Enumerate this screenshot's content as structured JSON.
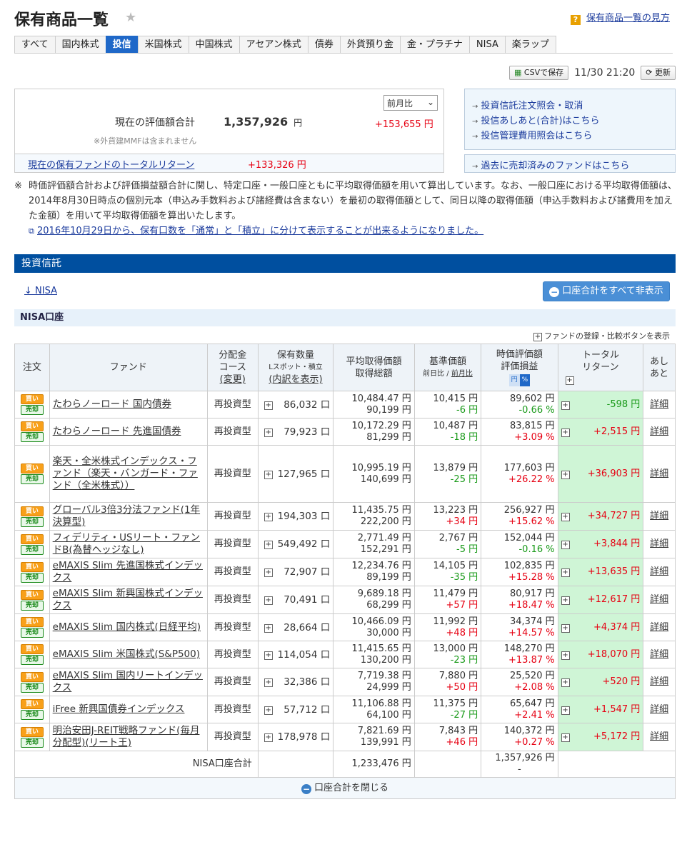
{
  "header": {
    "title": "保有商品一覧",
    "help_link": "保有商品一覧の見方",
    "help_mark": "?"
  },
  "tabs": [
    "すべて",
    "国内株式",
    "投信",
    "米国株式",
    "中国株式",
    "アセアン株式",
    "債券",
    "外貨預り金",
    "金・プラチナ",
    "NISA",
    "楽ラップ"
  ],
  "toolbar": {
    "csv": "CSVで保存",
    "timestamp": "11/30 21:20",
    "refresh": "更新"
  },
  "summary": {
    "label": "現在の評価額合計",
    "note": "※外貨建MMFは含まれません",
    "amount": "1,357,926",
    "yen": "円",
    "compare": "前月比",
    "delta": "+153,655 円",
    "total_return_label": "現在の保有ファンドのトータルリターン",
    "total_return_value": "+133,326 円"
  },
  "side_links": [
    "投資信託注文照会・取消",
    "投信あしあと(合計)はこちら",
    "投信管理費用照会はこちら",
    "過去に売却済みのファンドはこちら"
  ],
  "note": {
    "mark": "※",
    "text": "時価評価額合計および評価損益額合計に関し、特定口座・一般口座ともに平均取得価額を用いて算出しています。なお、一般口座における平均取得価額は、2014年8月30日時点の個別元本（申込み手数料および諸経費は含まない）を最初の取得価額として、同日以降の取得価額（申込手数料および諸費用を加えた金額）を用いて平均取得価額を算出いたします。",
    "link": "2016年10月29日から、保有口数を「通常」と「積立」に分けて表示することが出来るようになりました。"
  },
  "section": {
    "title": "投資信託",
    "nisa_link": "↓ NISA",
    "hide_all": "口座合計をすべて非表示",
    "subsection": "NISA口座",
    "register": "ファンドの登録・比較ボタンを表示"
  },
  "table": {
    "headers": {
      "order": "注文",
      "fund": "ファンド",
      "course1": "分配金",
      "course2": "コース",
      "course3": "(変更)",
      "qty1": "保有数量",
      "qty2": "Lスポット・積立",
      "qty3": "(内訳を表示)",
      "avg1": "平均取得価額",
      "avg2": "取得総額",
      "base1": "基準価額",
      "base2": "前日比 / ",
      "base3": "前月比",
      "eval1": "時価評価額",
      "eval2": "評価損益",
      "eval_yen": "円",
      "eval_pct": "%",
      "ret1": "トータル",
      "ret2": "リターン",
      "foot1": "あし",
      "foot2": "あと"
    },
    "buy": "買い",
    "sell": "売却",
    "detail": "詳細",
    "rows": [
      {
        "fund": "たわらノーロード 国内債券",
        "course": "再投資型",
        "qty": "86,032 口",
        "avg": "10,484.47 円",
        "total": "90,199 円",
        "base": "10,415 円",
        "base_chg": "-6 円",
        "eval": "89,602 円",
        "eval_pct": "-0.66 %",
        "ret": "-598 円",
        "pos_chg": false,
        "pos_pct": false,
        "pos_ret": false
      },
      {
        "fund": "たわらノーロード 先進国債券",
        "course": "再投資型",
        "qty": "79,923 口",
        "avg": "10,172.29 円",
        "total": "81,299 円",
        "base": "10,487 円",
        "base_chg": "-18 円",
        "eval": "83,815 円",
        "eval_pct": "+3.09 %",
        "ret": "+2,515 円",
        "pos_chg": false,
        "pos_pct": true,
        "pos_ret": true
      },
      {
        "fund": "楽天・全米株式インデックス・ファンド（楽天・バンガード・ファンド（全米株式））",
        "course": "再投資型",
        "qty": "127,965 口",
        "avg": "10,995.19 円",
        "total": "140,699 円",
        "base": "13,879 円",
        "base_chg": "-25 円",
        "eval": "177,603 円",
        "eval_pct": "+26.22 %",
        "ret": "+36,903 円",
        "pos_chg": false,
        "pos_pct": true,
        "pos_ret": true
      },
      {
        "fund": "グローバル3倍3分法ファンド(1年決算型)",
        "course": "再投資型",
        "qty": "194,303 口",
        "avg": "11,435.75 円",
        "total": "222,200 円",
        "base": "13,223 円",
        "base_chg": "+34 円",
        "eval": "256,927 円",
        "eval_pct": "+15.62 %",
        "ret": "+34,727 円",
        "pos_chg": true,
        "pos_pct": true,
        "pos_ret": true
      },
      {
        "fund": "フィデリティ・USリート・ファンドB(為替ヘッジなし)",
        "course": "再投資型",
        "qty": "549,492 口",
        "avg": "2,771.49 円",
        "total": "152,291 円",
        "base": "2,767 円",
        "base_chg": "-5 円",
        "eval": "152,044 円",
        "eval_pct": "-0.16 %",
        "ret": "+3,844 円",
        "pos_chg": false,
        "pos_pct": false,
        "pos_ret": true
      },
      {
        "fund": "eMAXIS Slim 先進国株式インデックス",
        "course": "再投資型",
        "qty": "72,907 口",
        "avg": "12,234.76 円",
        "total": "89,199 円",
        "base": "14,105 円",
        "base_chg": "-35 円",
        "eval": "102,835 円",
        "eval_pct": "+15.28 %",
        "ret": "+13,635 円",
        "pos_chg": false,
        "pos_pct": true,
        "pos_ret": true
      },
      {
        "fund": "eMAXIS Slim 新興国株式インデックス",
        "course": "再投資型",
        "qty": "70,491 口",
        "avg": "9,689.18 円",
        "total": "68,299 円",
        "base": "11,479 円",
        "base_chg": "+57 円",
        "eval": "80,917 円",
        "eval_pct": "+18.47 %",
        "ret": "+12,617 円",
        "pos_chg": true,
        "pos_pct": true,
        "pos_ret": true
      },
      {
        "fund": "eMAXIS Slim 国内株式(日経平均)",
        "course": "再投資型",
        "qty": "28,664 口",
        "avg": "10,466.09 円",
        "total": "30,000 円",
        "base": "11,992 円",
        "base_chg": "+48 円",
        "eval": "34,374 円",
        "eval_pct": "+14.57 %",
        "ret": "+4,374 円",
        "pos_chg": true,
        "pos_pct": true,
        "pos_ret": true
      },
      {
        "fund": "eMAXIS Slim 米国株式(S&P500)",
        "course": "再投資型",
        "qty": "114,054 口",
        "avg": "11,415.65 円",
        "total": "130,200 円",
        "base": "13,000 円",
        "base_chg": "-23 円",
        "eval": "148,270 円",
        "eval_pct": "+13.87 %",
        "ret": "+18,070 円",
        "pos_chg": false,
        "pos_pct": true,
        "pos_ret": true
      },
      {
        "fund": "eMAXIS Slim 国内リートインデックス",
        "course": "再投資型",
        "qty": "32,386 口",
        "avg": "7,719.38 円",
        "total": "24,999 円",
        "base": "7,880 円",
        "base_chg": "+50 円",
        "eval": "25,520 円",
        "eval_pct": "+2.08 %",
        "ret": "+520 円",
        "pos_chg": true,
        "pos_pct": true,
        "pos_ret": true
      },
      {
        "fund": "iFree 新興国債券インデックス",
        "course": "再投資型",
        "qty": "57,712 口",
        "avg": "11,106.88 円",
        "total": "64,100 円",
        "base": "11,375 円",
        "base_chg": "-27 円",
        "eval": "65,647 円",
        "eval_pct": "+2.41 %",
        "ret": "+1,547 円",
        "pos_chg": false,
        "pos_pct": true,
        "pos_ret": true
      },
      {
        "fund": "明治安田J-REIT戦略ファンド(毎月分配型)(リート王)",
        "course": "再投資型",
        "qty": "178,978 口",
        "avg": "7,821.69 円",
        "total": "139,991 円",
        "base": "7,843 円",
        "base_chg": "+46 円",
        "eval": "140,372 円",
        "eval_pct": "+0.27 %",
        "ret": "+5,172 円",
        "pos_chg": true,
        "pos_pct": true,
        "pos_ret": true
      }
    ],
    "total_label": "NISA口座合計",
    "total_cost": "1,233,476 円",
    "total_eval": "1,357,926 円",
    "total_dash": "-",
    "close": "口座合計を閉じる"
  }
}
